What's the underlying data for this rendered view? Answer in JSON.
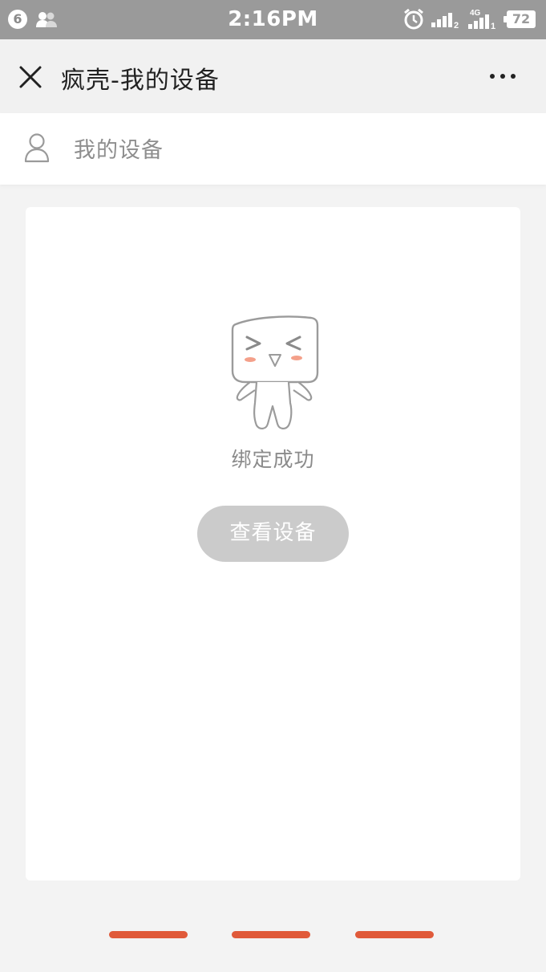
{
  "status_bar": {
    "notification_count": "6",
    "time": "2:16PM",
    "network": "4G",
    "battery": "72"
  },
  "header": {
    "title": "疯壳-我的设备"
  },
  "sub_header": {
    "title": "我的设备"
  },
  "result": {
    "message": "绑定成功",
    "button_label": "查看设备"
  },
  "colors": {
    "status_bar_bg": "#9a9a9a",
    "accent_dash": "#e05a3a",
    "button_bg": "#cbcbcb",
    "mascot_blush": "#f4a08a"
  },
  "icons": {
    "close": "close-icon",
    "more": "more-icon",
    "user": "user-icon",
    "mascot": "mascot-image",
    "alarm": "alarm-icon"
  },
  "pagination": {
    "dot_count": 3
  }
}
